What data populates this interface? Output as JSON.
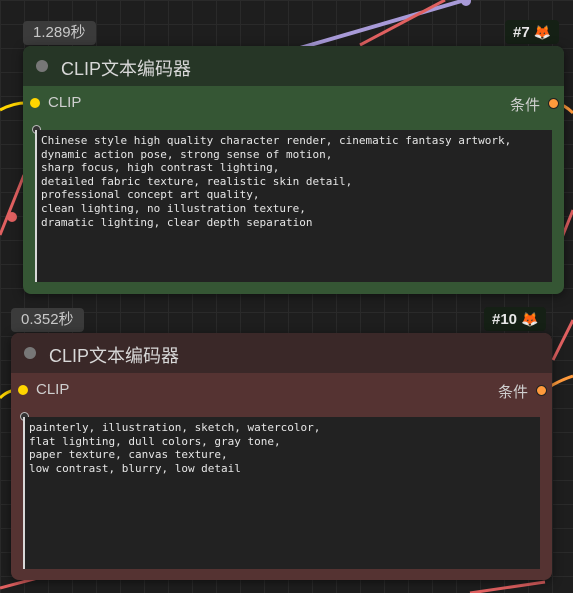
{
  "colors": {
    "node1_header": "#263626",
    "node1_body": "#355634",
    "node2_header": "#3a2828",
    "node2_body": "#553332",
    "wire_clip": "#ffd500",
    "wire_cond": "#ff9a3c",
    "wire_lavender": "#a89ad8",
    "wire_red": "#e06060"
  },
  "nodes": [
    {
      "timing": "1.289秒",
      "id_badge": "#7",
      "badge_icon": "🦊",
      "title": "CLIP文本编码器",
      "input_label": "CLIP",
      "output_label": "条件",
      "text_value": "Chinese style high quality character render, cinematic fantasy artwork,\ndynamic action pose, strong sense of motion,\nsharp focus, high contrast lighting,\ndetailed fabric texture, realistic skin detail,\nprofessional concept art quality,\nclean lighting, no illustration texture,\ndramatic lighting, clear depth separation"
    },
    {
      "timing": "0.352秒",
      "id_badge": "#10",
      "badge_icon": "🦊",
      "title": "CLIP文本编码器",
      "input_label": "CLIP",
      "output_label": "条件",
      "text_value": "painterly, illustration, sketch, watercolor,\nflat lighting, dull colors, gray tone,\npaper texture, canvas texture,\nlow contrast, blurry, low detail"
    }
  ]
}
